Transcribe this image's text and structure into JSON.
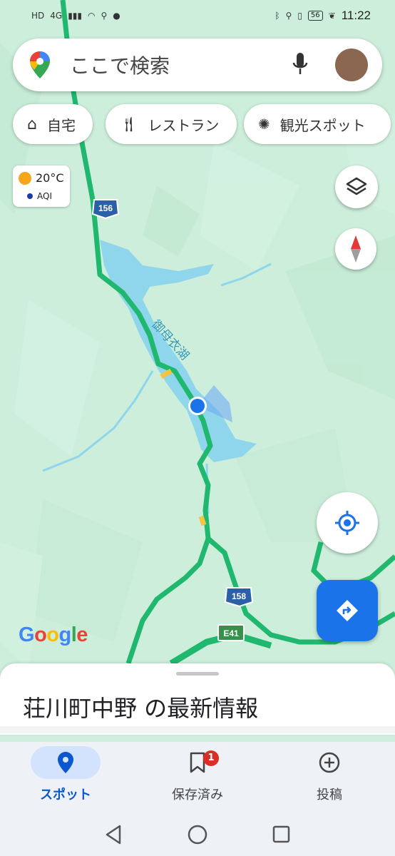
{
  "status_bar": {
    "left_icons": [
      "HD",
      "4G",
      "signal-icon",
      "wifi-icon",
      "location-icon",
      "line-icon"
    ],
    "battery": "56",
    "time": "11:22"
  },
  "search": {
    "placeholder": "ここで検索"
  },
  "chips": [
    {
      "label": "自宅",
      "icon": "home-icon"
    },
    {
      "label": "レストラン",
      "icon": "restaurant-icon"
    },
    {
      "label": "観光スポット",
      "icon": "attraction-icon"
    }
  ],
  "weather": {
    "temp": "20°C",
    "aqi": "AQI"
  },
  "map": {
    "lake_label": "御母衣湖",
    "route_shields": [
      "156",
      "158"
    ],
    "expressway": "E41",
    "logo": "Google"
  },
  "sheet": {
    "title": "荘川町中野 の最新情報"
  },
  "bottom_nav": [
    {
      "label": "スポット",
      "active": true
    },
    {
      "label": "保存済み",
      "badge": "1"
    },
    {
      "label": "投稿"
    }
  ],
  "colors": {
    "accent": "#1a73e8",
    "road": "#20c080",
    "water": "#8fd6ec",
    "land": "#cfeedd"
  }
}
